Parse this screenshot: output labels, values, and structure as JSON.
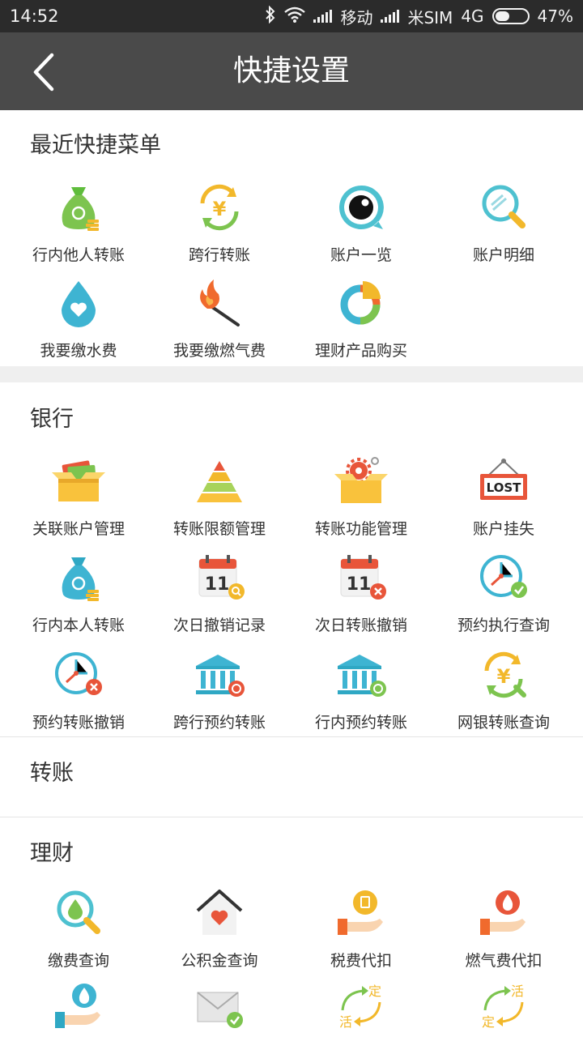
{
  "status_bar": {
    "time": "14:52",
    "carrier1": "移动",
    "carrier2": "米SIM",
    "network": "4G",
    "battery": "47%",
    "battery_level": 0.47
  },
  "header": {
    "title": "快捷设置"
  },
  "sections": {
    "recent": {
      "title": "最近快捷菜单",
      "items": [
        "行内他人转账",
        "跨行转账",
        "账户一览",
        "账户明细",
        "我要缴水费",
        "我要缴燃气费",
        "理财产品购买"
      ]
    },
    "bank": {
      "title": "银行",
      "items": [
        "关联账户管理",
        "转账限额管理",
        "转账功能管理",
        "账户挂失",
        "行内本人转账",
        "次日撤销记录",
        "次日转账撤销",
        "预约执行查询",
        "预约转账撤销",
        "跨行预约转账",
        "行内预约转账",
        "网银转账查询"
      ]
    },
    "transfer": {
      "title": "转账"
    },
    "wealth": {
      "title": "理财",
      "items": [
        "缴费查询",
        "公积金查询",
        "税费代扣",
        "燃气费代扣"
      ]
    }
  },
  "icon_text": {
    "lost": "LOST",
    "date": "11",
    "yen": "¥",
    "ding": "定",
    "huo": "活"
  }
}
